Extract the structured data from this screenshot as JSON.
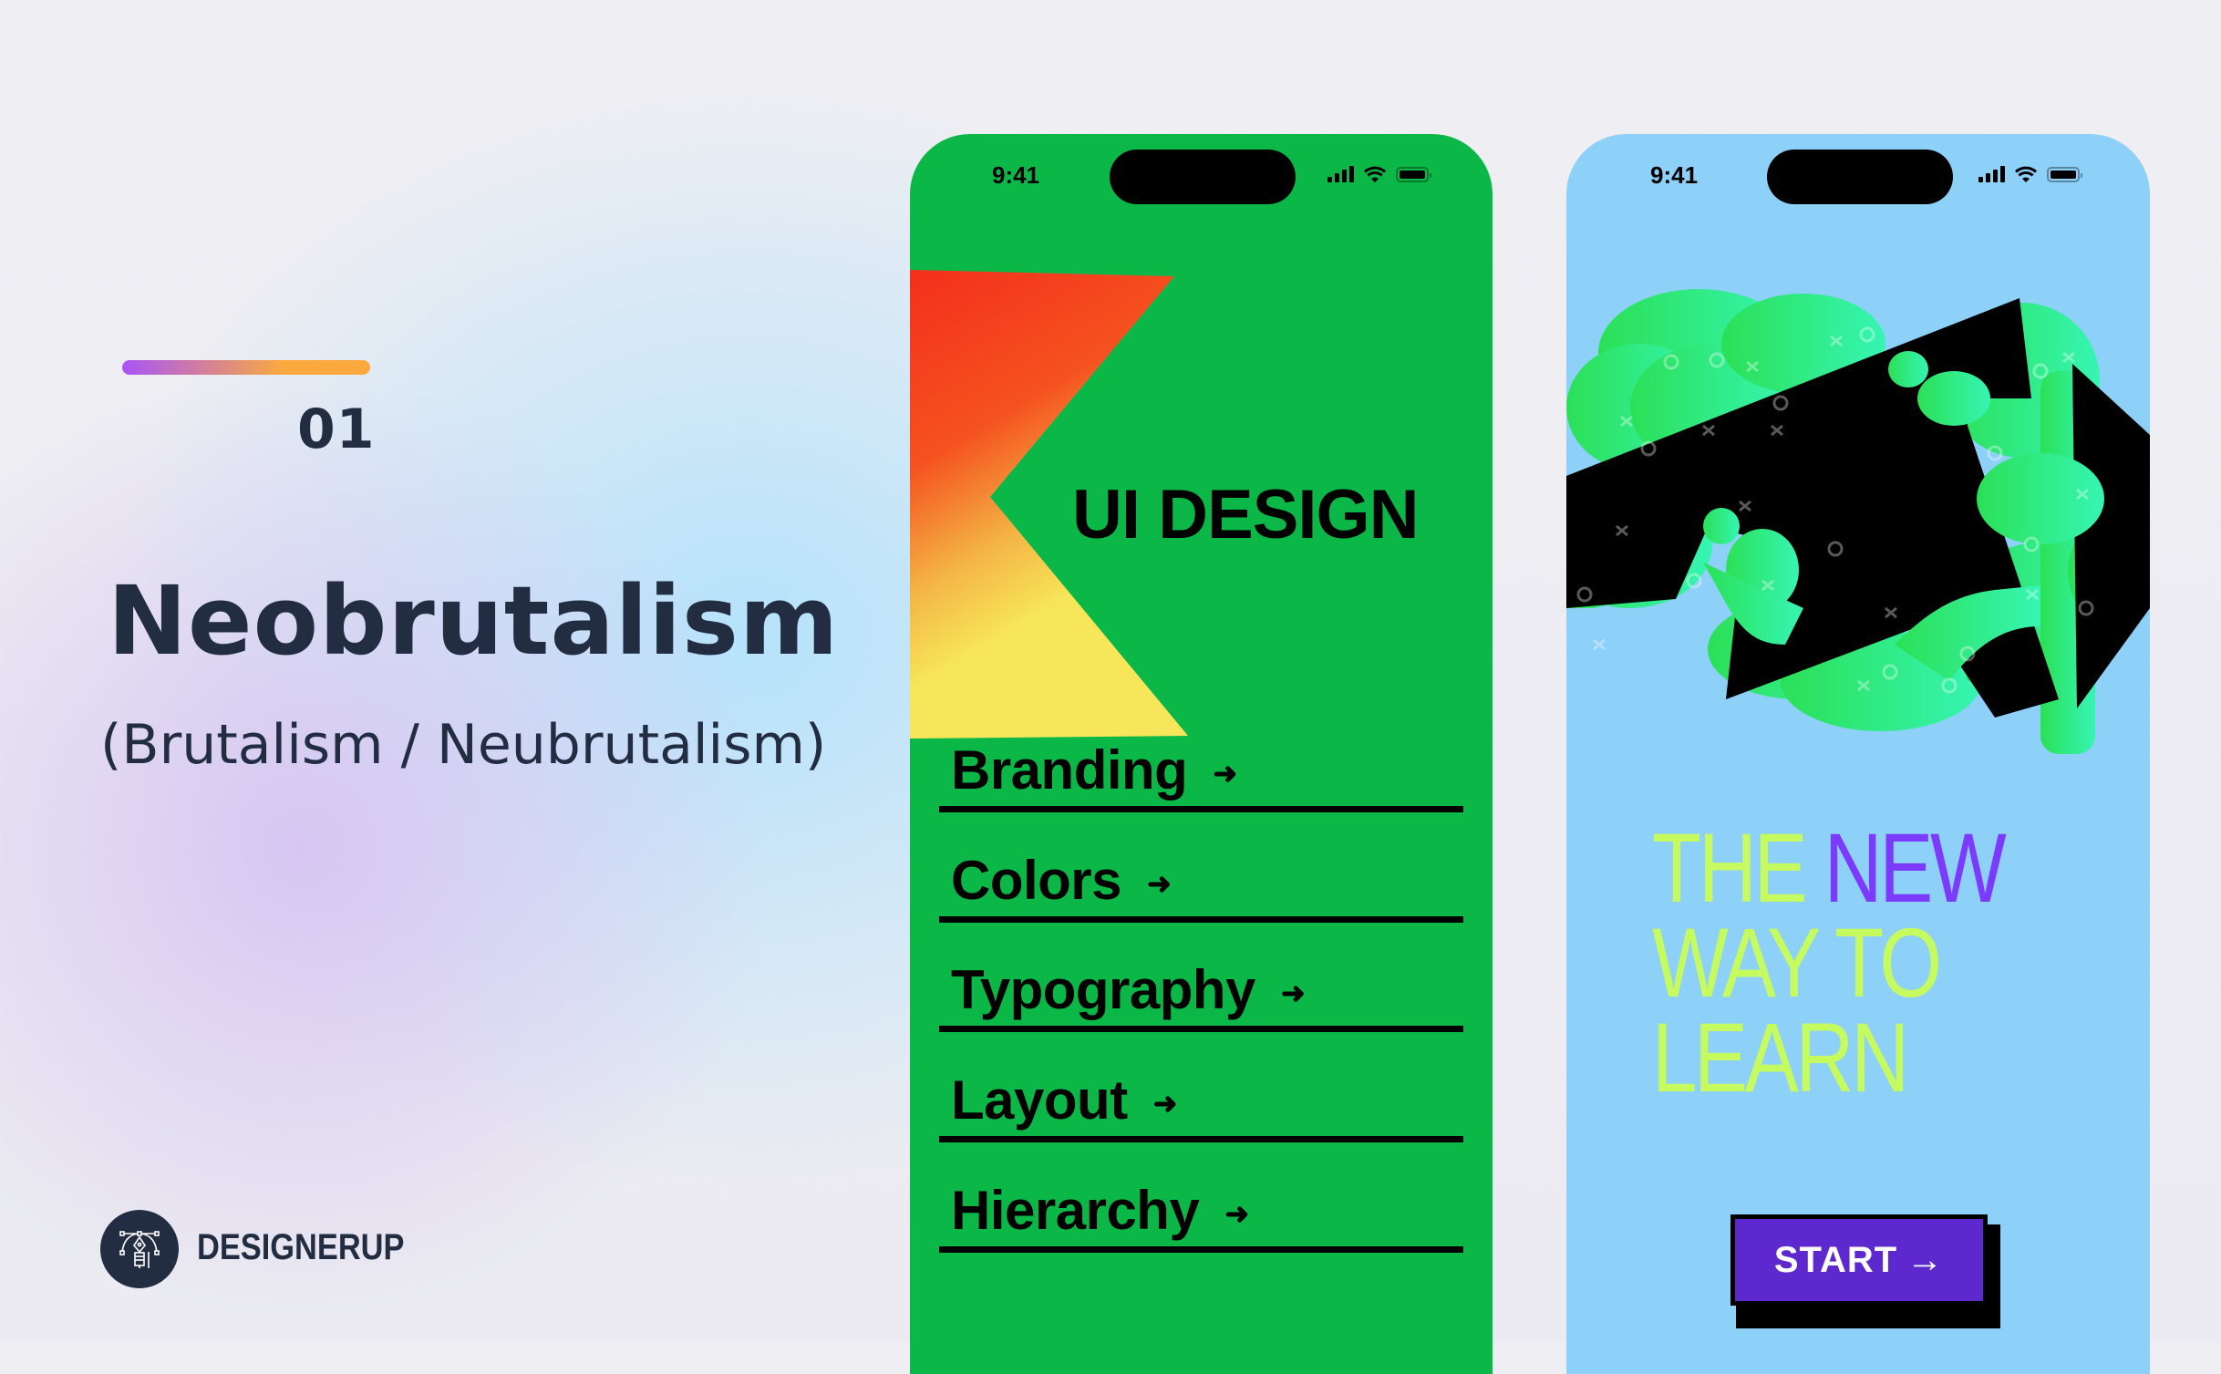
{
  "slide": {
    "accent_bar_colors": [
      "#a855f7",
      "#fba93f"
    ],
    "number": "01",
    "title": "Neobrutalism",
    "subtitle": "(Brutalism / Neubrutalism)",
    "text_color": "#232d42"
  },
  "brand": {
    "name": "DESIGNERUP",
    "icon": "pen-tool-icon"
  },
  "phone_green": {
    "background": "#0bb847",
    "status": {
      "time": "9:41",
      "icons": [
        "cellular-signal-icon",
        "wifi-icon",
        "battery-icon"
      ]
    },
    "hero_title": "UI DESIGN",
    "flag_colors": [
      "#f42f1c",
      "#f7e65a"
    ],
    "menu": [
      {
        "label": "Branding",
        "arrow": "➜"
      },
      {
        "label": "Colors",
        "arrow": "➜"
      },
      {
        "label": "Typography",
        "arrow": "➜"
      },
      {
        "label": "Layout",
        "arrow": "➜"
      },
      {
        "label": "Hierarchy",
        "arrow": "➜"
      }
    ]
  },
  "phone_blue": {
    "background": "#8dd0f8",
    "status": {
      "time": "9:41",
      "icons": [
        "cellular-signal-icon",
        "wifi-icon",
        "battery-icon"
      ]
    },
    "headline": {
      "line1_a": "THE",
      "line1_b": "NEW",
      "line2": "WAY TO",
      "line3": "LEARN",
      "color_primary": "#c6fb5f",
      "color_accent": "#7c3aff"
    },
    "cta": {
      "label": "START",
      "arrow": "→",
      "color": "#5e28cf"
    },
    "illustration_colors": [
      "#000000",
      "#2fe46a",
      "#36f5b3"
    ]
  }
}
